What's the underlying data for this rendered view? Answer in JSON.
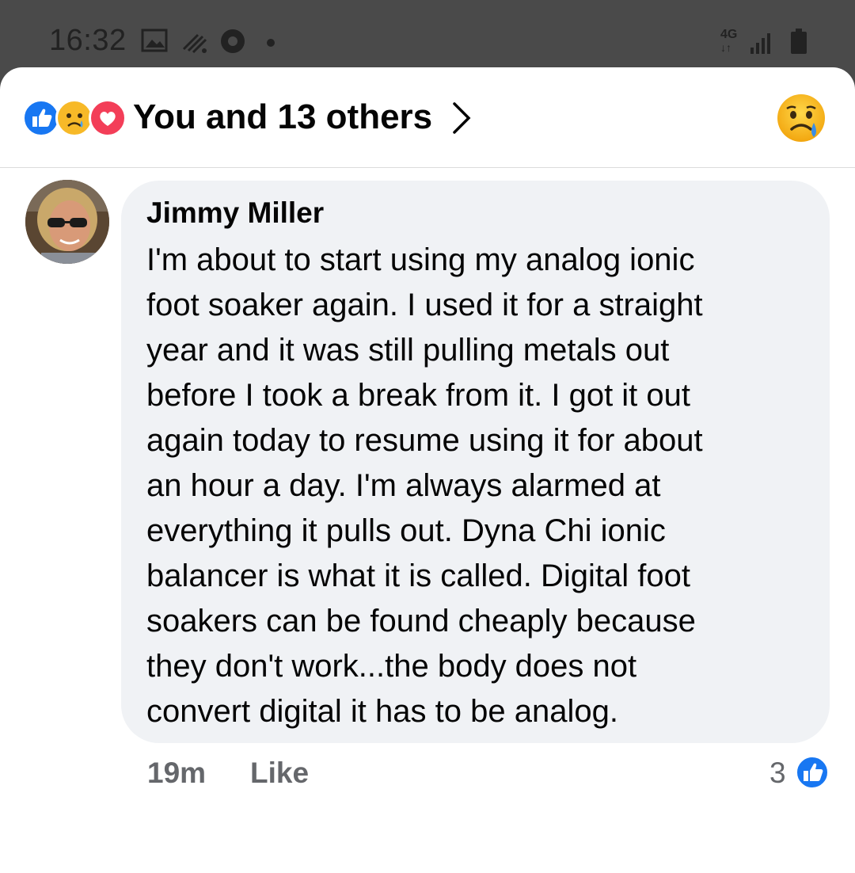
{
  "status_bar": {
    "time": "16:32",
    "network": "4G",
    "icons": [
      "gallery-icon",
      "signal-waves-icon",
      "chrome-icon",
      "dot-icon",
      "network-4g-icon",
      "cell-signal-icon",
      "battery-icon"
    ]
  },
  "header": {
    "reaction_icons": [
      "like-reaction-icon",
      "sad-reaction-icon",
      "love-reaction-icon"
    ],
    "title": "You and 13 others",
    "chevron_icon": "chevron-right-icon",
    "my_reaction_icon": "sad-reaction-icon"
  },
  "comment": {
    "author": "Jimmy Miller",
    "text": "I'm about to start using my analog ionic\nfoot soaker again. I used it for a straight\nyear and it was still pulling metals out\nbefore I took a break from it.  I got it out\nagain today to resume using it for about\nan hour a day. I'm always alarmed at\neverything it pulls out.  Dyna Chi ionic\nbalancer is what it is called. Digital foot\nsoakers can be found cheaply because\nthey don't work...the body does not\nconvert digital it has to be analog.",
    "time_ago": "19m",
    "like_label": "Like",
    "reaction_count": "3"
  },
  "colors": {
    "facebook_blue": "#1877f2",
    "love_red": "#f33e58",
    "sad_yellow": "#f7b928",
    "bubble_bg": "#f0f2f5",
    "meta_gray": "#65676b"
  }
}
